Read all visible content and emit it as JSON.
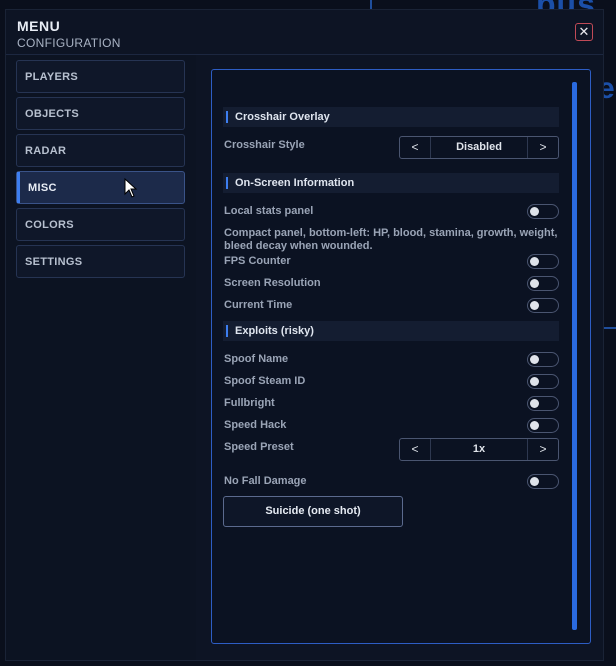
{
  "background": {
    "text_top": "bus",
    "text_side": "e"
  },
  "header": {
    "title": "MENU",
    "subtitle": "CONFIGURATION",
    "close_glyph": "✕"
  },
  "sidebar": {
    "items": [
      {
        "label": "PLAYERS",
        "active": false
      },
      {
        "label": "OBJECTS",
        "active": false
      },
      {
        "label": "RADAR",
        "active": false
      },
      {
        "label": "MISC",
        "active": true
      },
      {
        "label": "COLORS",
        "active": false
      },
      {
        "label": "SETTINGS",
        "active": false
      }
    ]
  },
  "panel": {
    "sections": {
      "crosshair": "Crosshair Overlay",
      "onscreen": "On-Screen Information",
      "exploits": "Exploits (risky)"
    },
    "crosshair_style": {
      "label": "Crosshair Style",
      "value": "Disabled",
      "prev": "<",
      "next": ">"
    },
    "local_stats": {
      "label": "Local stats panel",
      "on": false
    },
    "local_stats_desc": "Compact panel, bottom-left: HP, blood, stamina, growth, weight, bleed decay when wounded.",
    "fps_counter": {
      "label": "FPS Counter",
      "on": false
    },
    "screen_resolution": {
      "label": "Screen Resolution",
      "on": false
    },
    "current_time": {
      "label": "Current Time",
      "on": false
    },
    "spoof_name": {
      "label": "Spoof Name",
      "on": false
    },
    "spoof_steam_id": {
      "label": "Spoof Steam ID",
      "on": false
    },
    "fullbright": {
      "label": "Fullbright",
      "on": false
    },
    "speed_hack": {
      "label": "Speed Hack",
      "on": false
    },
    "speed_preset": {
      "label": "Speed Preset",
      "value": "1x",
      "prev": "<",
      "next": ">"
    },
    "no_fall_damage": {
      "label": "No Fall Damage",
      "on": false
    },
    "suicide_button": "Suicide (one shot)"
  },
  "colors": {
    "accent": "#3d7ef0",
    "panel_border": "#2d5dc4",
    "close_border": "#c04a57"
  }
}
